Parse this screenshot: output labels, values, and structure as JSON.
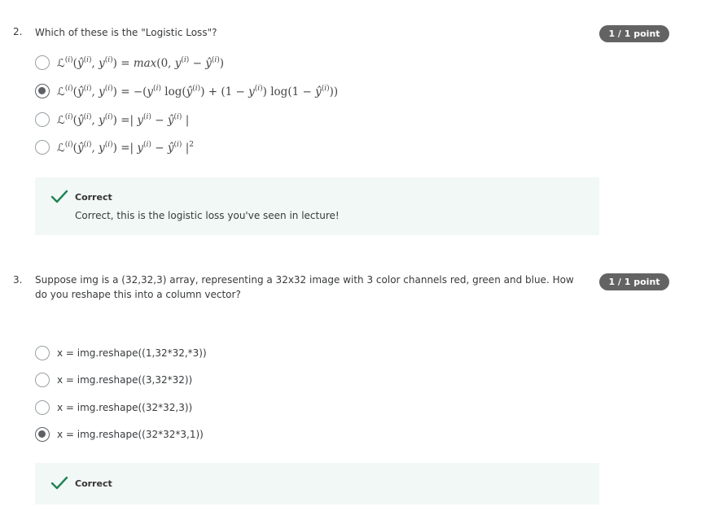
{
  "colors": {
    "badge_bg": "#636363",
    "feedback_bg": "#f2f8f6",
    "check_green": "#1f8354"
  },
  "questions": [
    {
      "number": "2.",
      "text": "Which of these is the \"Logistic Loss\"?",
      "points": "1 / 1 point",
      "options": [
        {
          "label": "ℒ(i)(ŷ(i), y(i)) = max(0, y(i) − ŷ(i))",
          "selected": false
        },
        {
          "label": "ℒ(i)(ŷ(i), y(i)) = −(y(i) log(ŷ(i)) + (1 − y(i)) log(1 − ŷ(i)))",
          "selected": true
        },
        {
          "label": "ℒ(i)(ŷ(i), y(i)) =| y(i) − ŷ(i) |",
          "selected": false
        },
        {
          "label": "ℒ(i)(ŷ(i), y(i)) =| y(i) − ŷ(i) |2",
          "selected": false
        }
      ],
      "feedback": {
        "icon": "check-icon",
        "title": "Correct",
        "text": "Correct, this is the logistic loss you've seen in lecture!"
      }
    },
    {
      "number": "3.",
      "text": "Suppose img is a (32,32,3) array, representing a 32x32 image with 3 color channels red, green and blue. How do you reshape this into a column vector?",
      "points": "1 / 1 point",
      "options": [
        {
          "label": "x = img.reshape((1,32*32,*3))",
          "selected": false
        },
        {
          "label": "x = img.reshape((3,32*32))",
          "selected": false
        },
        {
          "label": "x = img.reshape((32*32,3))",
          "selected": false
        },
        {
          "label": "x = img.reshape((32*32*3,1))",
          "selected": true
        }
      ],
      "feedback": {
        "icon": "check-icon",
        "title": "Correct",
        "text": ""
      }
    }
  ]
}
